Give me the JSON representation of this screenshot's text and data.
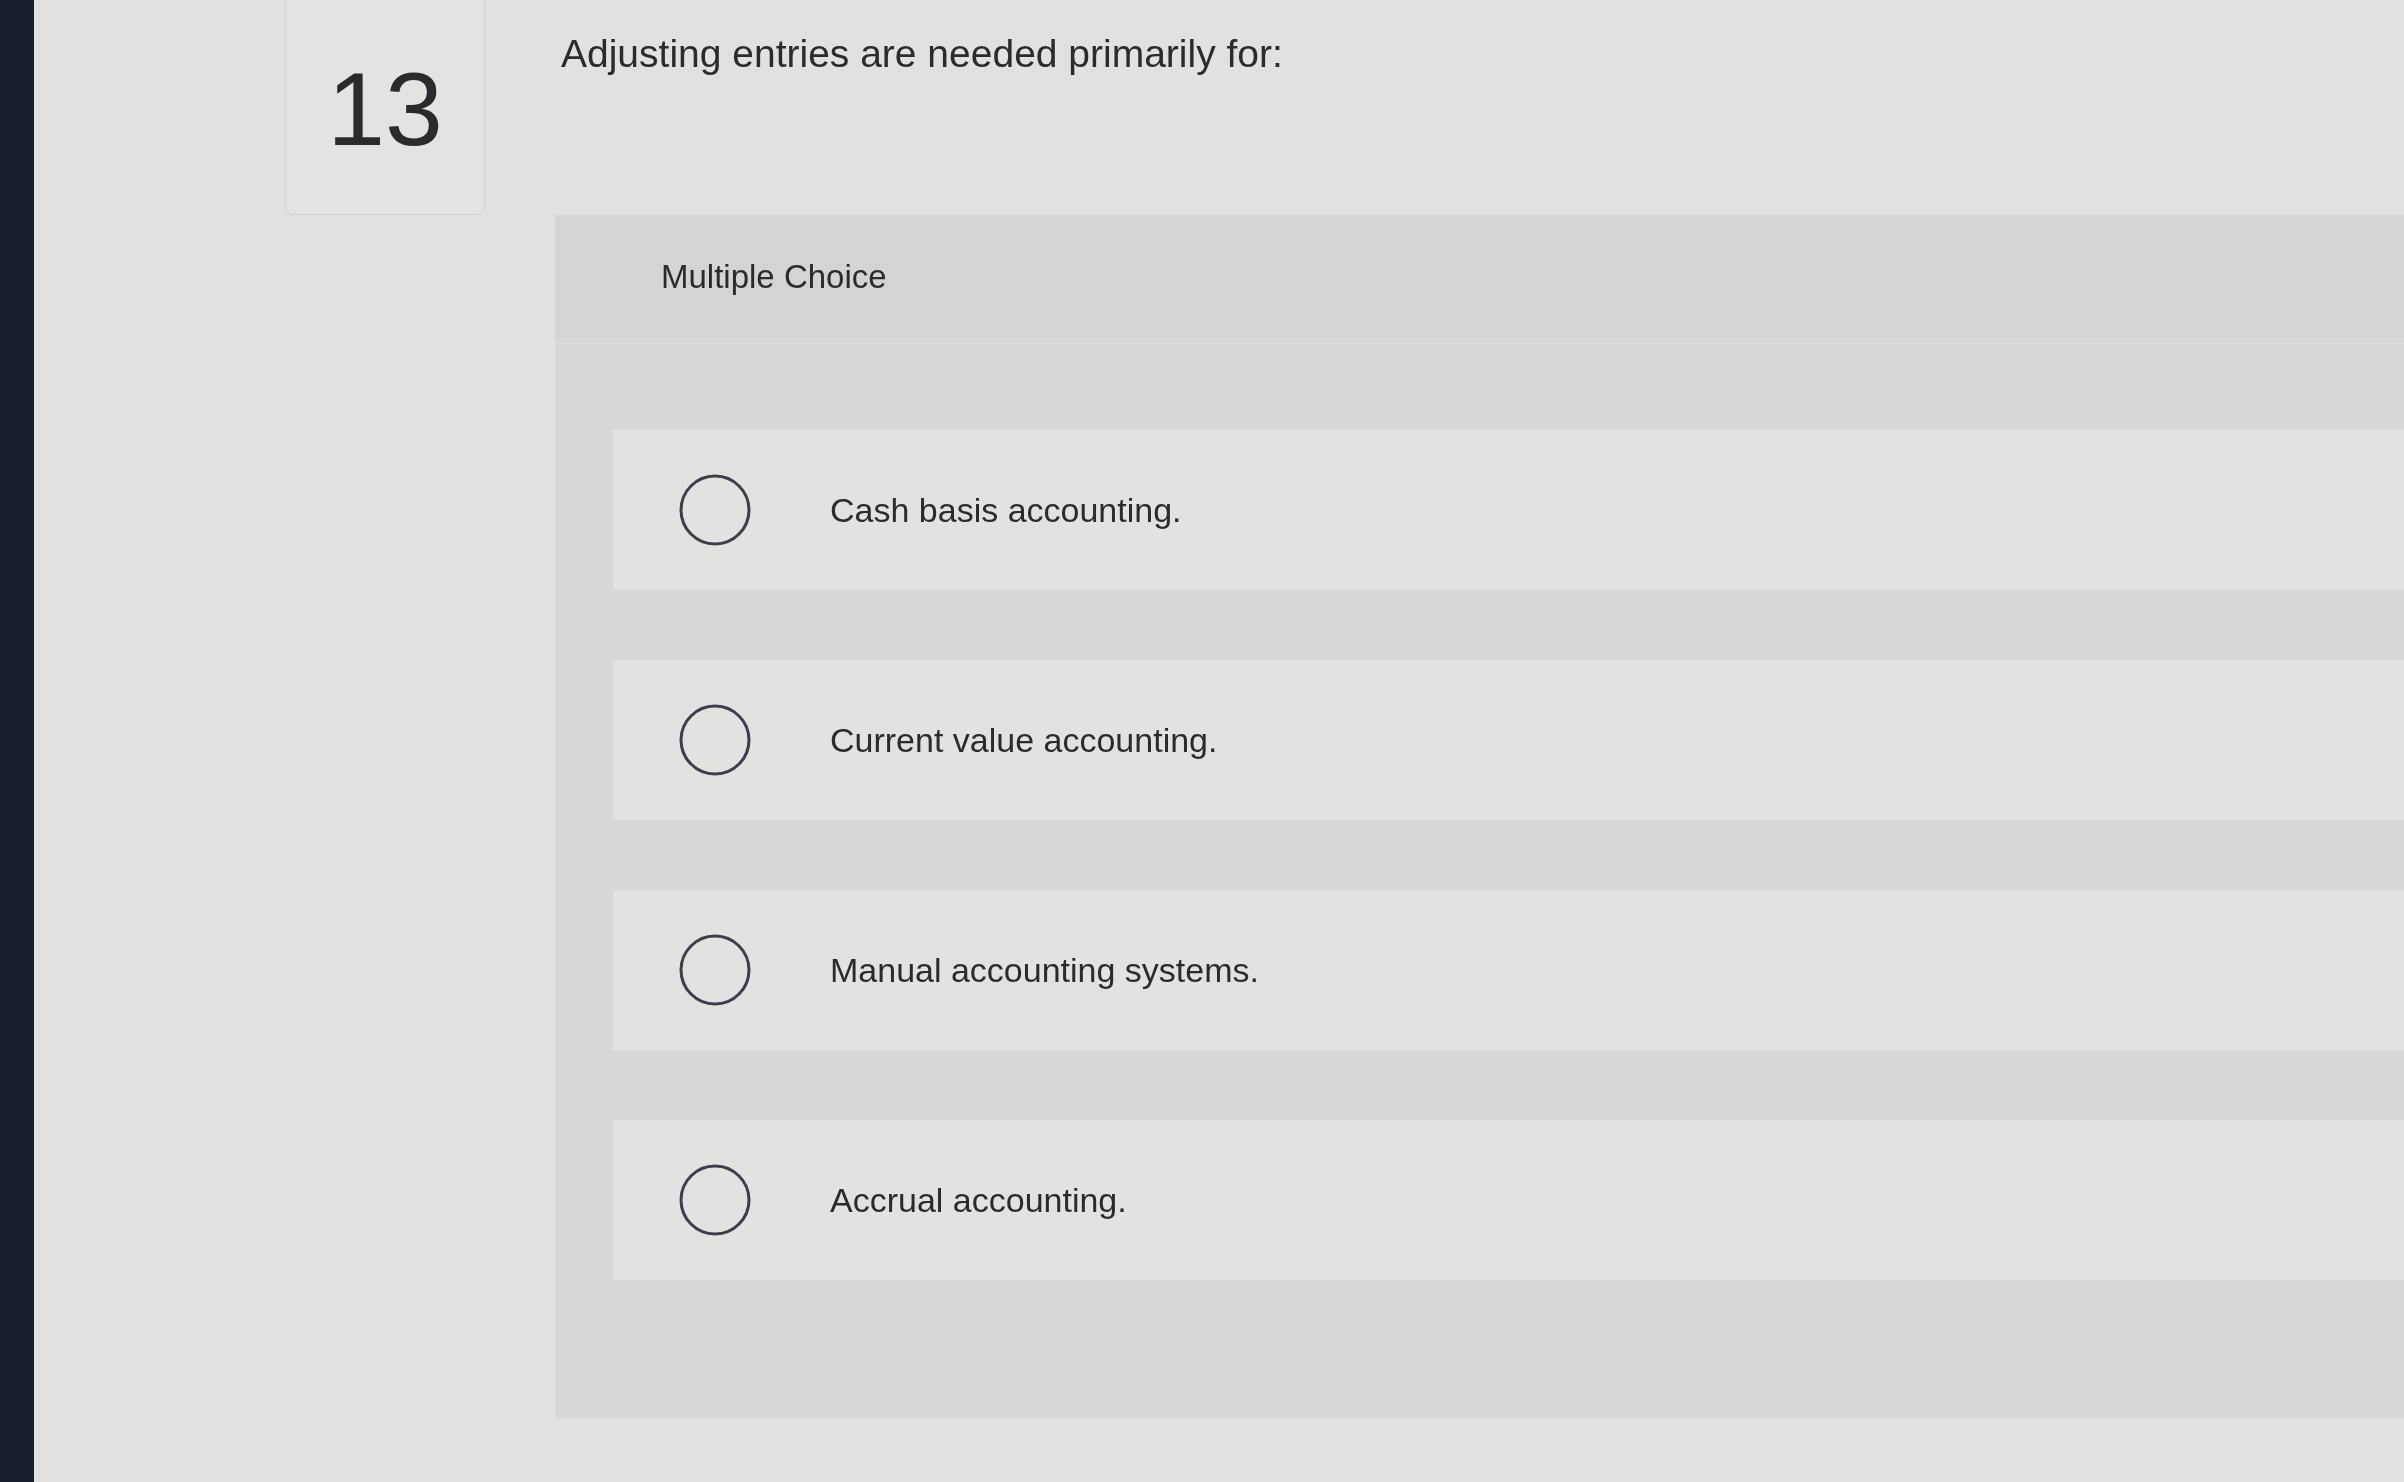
{
  "question": {
    "number": "13",
    "text": "Adjusting entries are needed primarily for:"
  },
  "answer_panel": {
    "type_label": "Multiple Choice",
    "options": [
      {
        "label": "Cash basis accounting.",
        "selected": false
      },
      {
        "label": "Current value accounting.",
        "selected": false
      },
      {
        "label": "Manual accounting systems.",
        "selected": false
      },
      {
        "label": "Accrual accounting.",
        "selected": false
      }
    ]
  }
}
